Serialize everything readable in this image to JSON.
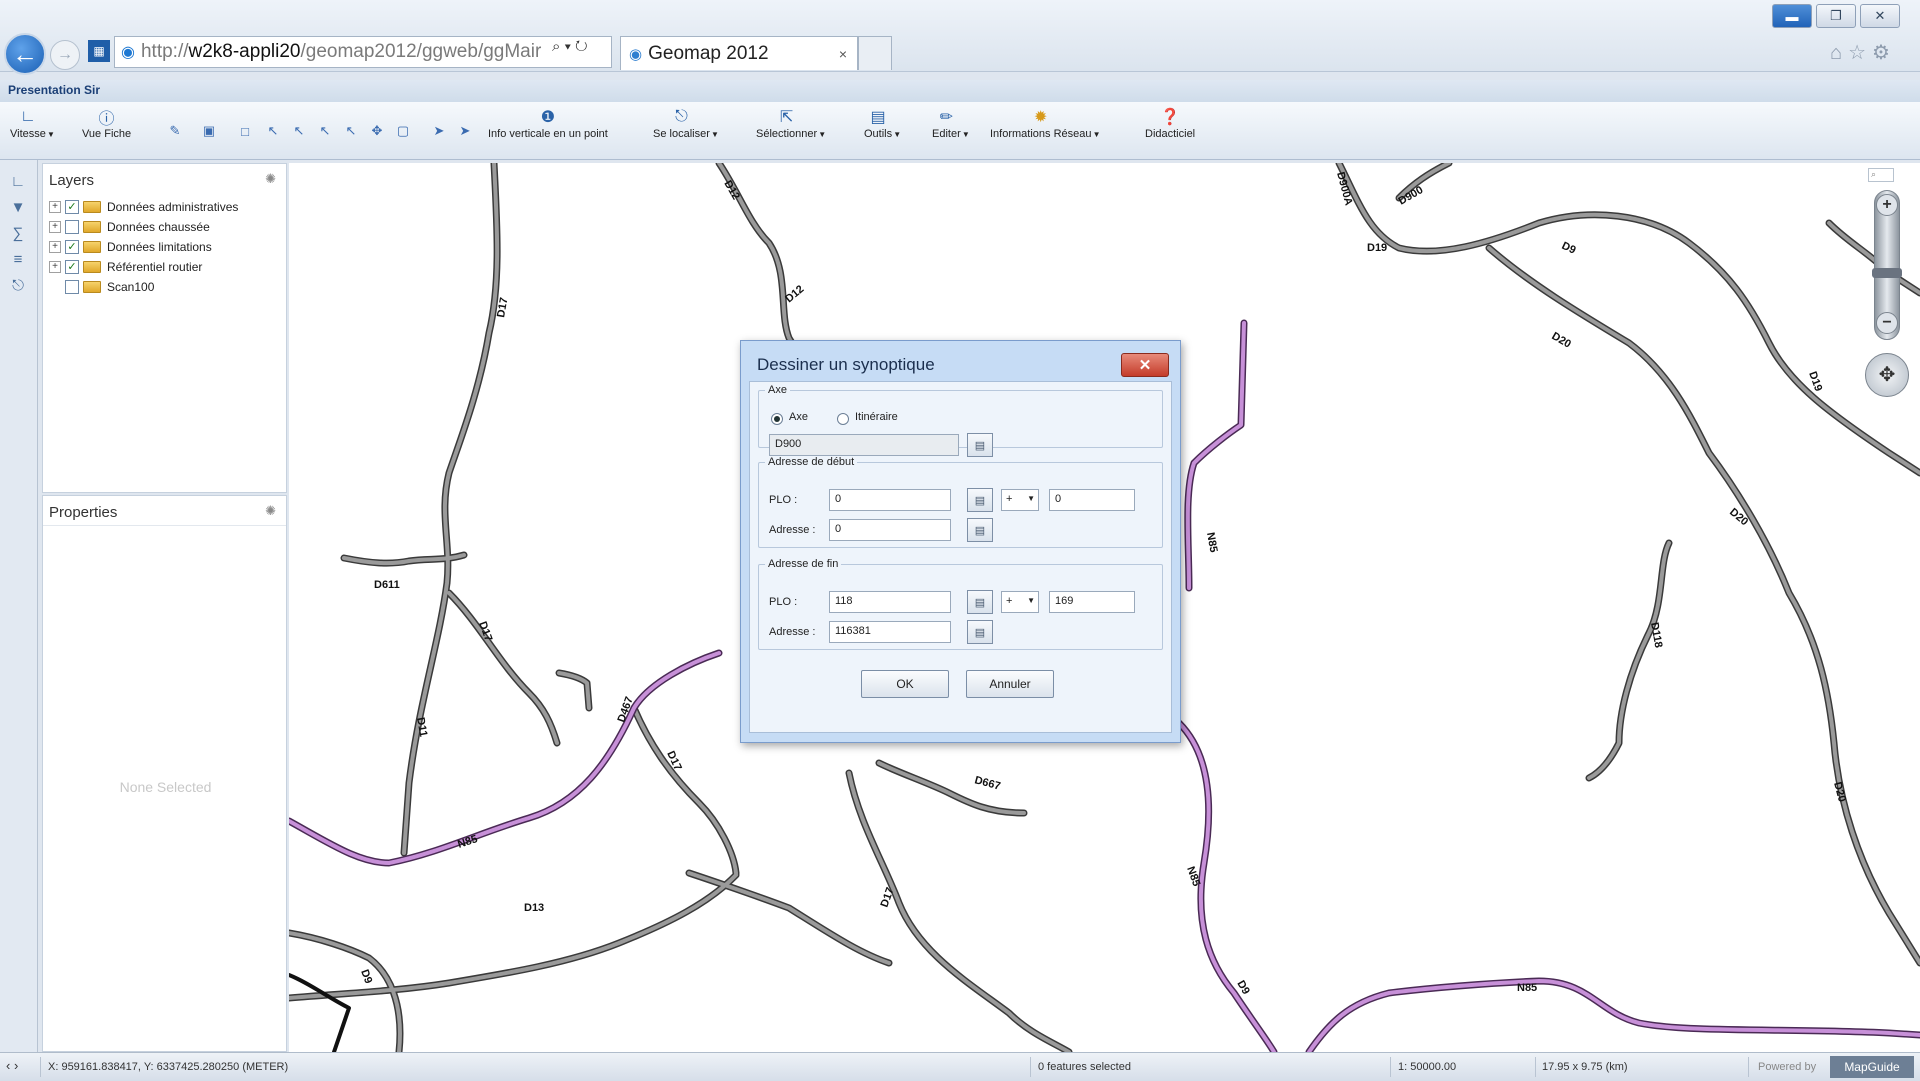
{
  "browser": {
    "url_prefix": "http://",
    "url_host": "w2k8-appli20",
    "url_path": "/geomap2012/ggweb/ggMair",
    "tab_title": "Geomap 2012",
    "tab_close": "×",
    "address_tools": "⌕ ▾ ↻",
    "win_min": "▬",
    "win_max": "❐",
    "win_close": "✕",
    "right_icons": "⌂☆⚙"
  },
  "app": {
    "title": "Presentation Sir"
  },
  "toolbar": {
    "vitesse": "Vitesse",
    "vue_fiche": "Vue Fiche",
    "info_verticale": "Info verticale en un point",
    "se_localiser": "Se localiser",
    "selectionner": "Sélectionner",
    "outils": "Outils",
    "editer": "Editer",
    "informations_reseau": "Informations Réseau",
    "didacticiel": "Didacticiel"
  },
  "layers": {
    "title": "Layers",
    "items": [
      {
        "label": "Données administratives"
      },
      {
        "label": "Données chaussée"
      },
      {
        "label": "Données limitations"
      },
      {
        "label": "Référentiel routier"
      },
      {
        "label": "Scan100"
      }
    ]
  },
  "properties": {
    "title": "Properties",
    "empty_text": "None Selected"
  },
  "dialog": {
    "title": "Dessiner un synoptique",
    "close_label": "✕",
    "axe_legend": "Axe",
    "radio_axe": "Axe",
    "radio_itineraire": "Itinéraire",
    "axe_value": "D900",
    "debut_legend": "Adresse de début",
    "fin_legend": "Adresse de fin",
    "plo_label": "PLO :",
    "adresse_label": "Adresse :",
    "debut_plo": "0",
    "debut_sign": "+",
    "debut_offset": "0",
    "debut_adresse": "0",
    "fin_plo": "118",
    "fin_sign": "+",
    "fin_offset": "169",
    "fin_adresse": "116381",
    "ok_label": "OK",
    "cancel_label": "Annuler"
  },
  "map_labels": [
    "D611",
    "D17",
    "D467",
    "D17",
    "D17",
    "D11",
    "D13",
    "D12",
    "D12",
    "N85",
    "N85",
    "N85",
    "D667",
    "D17",
    "D20",
    "D20",
    "D118",
    "D900A",
    "D900",
    "D19",
    "D9",
    "D20",
    "D19",
    "N85",
    "D9",
    "D9"
  ],
  "status": {
    "coords": "X: 959161.838417, Y: 6337425.280250 (METER)",
    "features": "0 features selected",
    "scale": "1: 50000.00",
    "extent": "17.95 x 9.75 (km)",
    "powered_by": "Powered by",
    "mapguide": "MapGuide"
  },
  "colors": {
    "road_gray": "#9a9a9a",
    "road_purple": "#b679c9",
    "dialog_bg": "#c6dcf5"
  }
}
